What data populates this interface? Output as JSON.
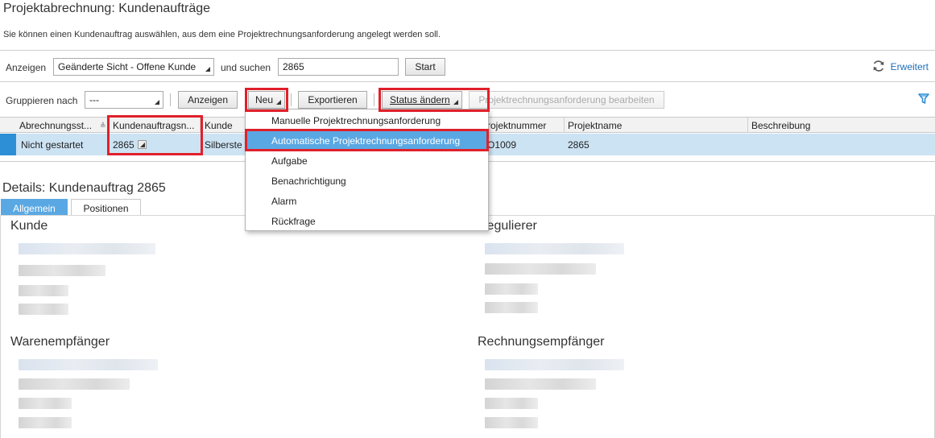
{
  "page": {
    "title": "Projektabrechnung: Kundenaufträge",
    "description": "Sie können einen Kundenauftrag auswählen, aus dem eine Projektrechnungsanforderung angelegt werden soll."
  },
  "search": {
    "show_label": "Anzeigen",
    "view_value": "Geänderte Sicht - Offene Kunde",
    "and_search_label": "und suchen",
    "query_value": "2865",
    "start_label": "Start",
    "advanced_label": "Erweitert"
  },
  "toolbar": {
    "group_by_label": "Gruppieren nach",
    "group_by_value": "---",
    "show_button": "Anzeigen",
    "new_button": "Neu",
    "export_button": "Exportieren",
    "status_button": "Status ändern",
    "edit_request_button": "Projektrechnungsanforderung bearbeiten"
  },
  "table": {
    "columns": [
      "Abrechnungsst...",
      "Kundenauftragsn...",
      "Kunde",
      "Projektnummer",
      "Projektname",
      "Beschreibung"
    ],
    "row": {
      "status": "Nicht gestartet",
      "order_number": "2865",
      "customer": "Silberste",
      "project_number": "SO1009",
      "project_name": "2865",
      "description": ""
    }
  },
  "new_menu": {
    "items": [
      "Manuelle Projektrechnungsanforderung",
      "Automatische Projektrechnungsanforderung",
      "Aufgabe",
      "Benachrichtigung",
      "Alarm",
      "Rückfrage"
    ],
    "highlighted_index": 1
  },
  "details": {
    "title": "Details: Kundenauftrag 2865",
    "tabs": [
      "Allgemein",
      "Positionen"
    ],
    "active_tab": 0,
    "sections": {
      "customer": "Kunde",
      "payer": "Regulierer",
      "ship_to": "Warenempfänger",
      "bill_to": "Rechnungsempfänger"
    }
  },
  "colors": {
    "accent": "#5aa8e3",
    "link": "#1f6fba",
    "selected_row": "#cce3f3",
    "highlight_box": "#e0202a"
  }
}
